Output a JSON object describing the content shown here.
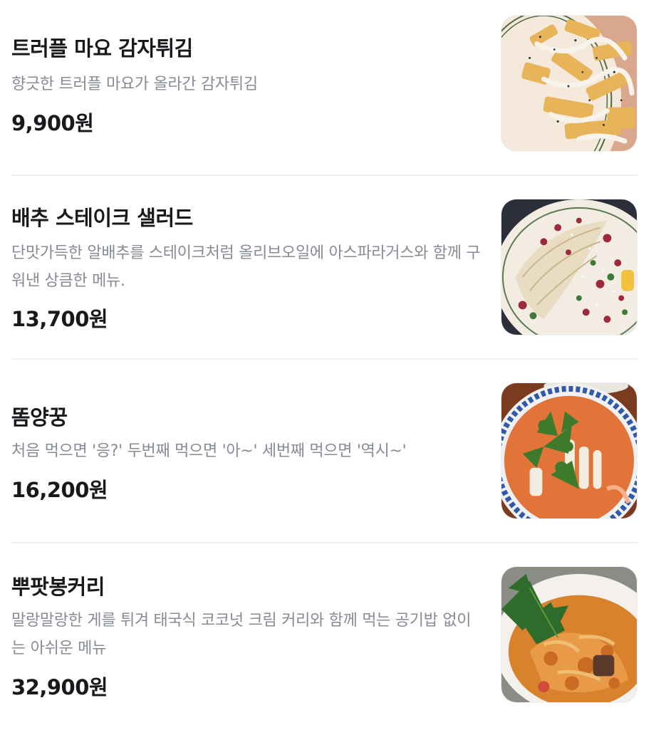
{
  "menu": {
    "items": [
      {
        "name": "트러플 마요 감자튀김",
        "description": "향긋한 트러플 마요가 올라간 감자튀김",
        "price": "9,900원",
        "image_icon": "fries-photo"
      },
      {
        "name": "배추 스테이크 샐러드",
        "description": "단맛가득한 알배추를 스테이크처럼 올리브오일에 아스파라거스와 함께 구워낸 상큼한 메뉴.",
        "price": "13,700원",
        "image_icon": "salad-photo"
      },
      {
        "name": "똠양꿍",
        "description": "처음 먹으면 '응?' 두번째 먹으면 '아~' 세번째 먹으면 '역시~'",
        "price": "16,200원",
        "image_icon": "tom-yum-photo"
      },
      {
        "name": "뿌팟봉커리",
        "description": "말랑말랑한 게를 튀겨 태국식 코코넛 크림 커리와 함께 먹는 공기밥 없이는 아쉬운 메뉴",
        "price": "32,900원",
        "image_icon": "curry-photo"
      }
    ]
  },
  "colors": {
    "title": "#17191c",
    "description": "#868b94",
    "divider": "#eeeff1",
    "background": "#ffffff"
  }
}
